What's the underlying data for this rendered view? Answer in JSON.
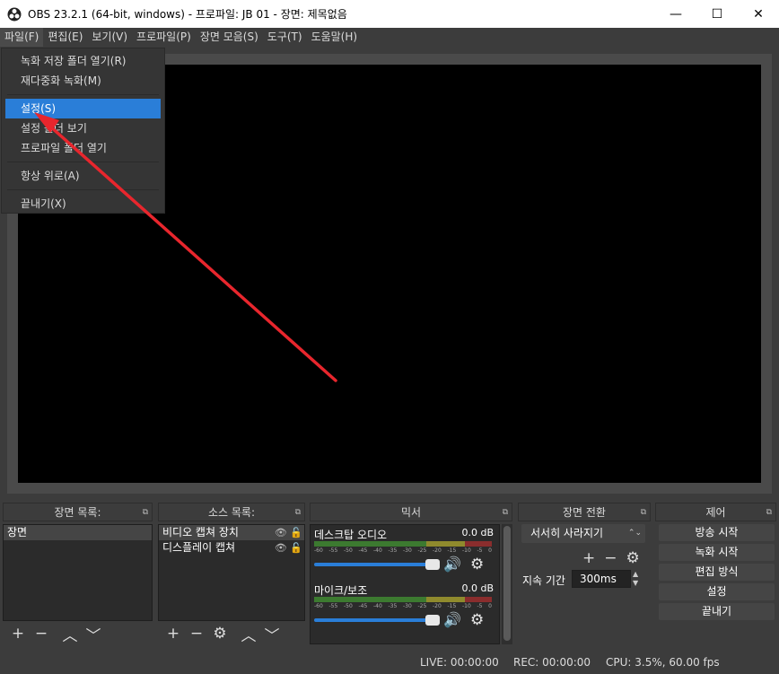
{
  "window": {
    "title": "OBS 23.2.1 (64-bit, windows) - 프로파일: JB 01 - 장면: 제목없음",
    "minimize": "—",
    "maximize": "☐",
    "close": "✕"
  },
  "menubar": [
    {
      "label": "파일(F)"
    },
    {
      "label": "편집(E)"
    },
    {
      "label": "보기(V)"
    },
    {
      "label": "프로파일(P)"
    },
    {
      "label": "장면 모음(S)"
    },
    {
      "label": "도구(T)"
    },
    {
      "label": "도움말(H)"
    }
  ],
  "file_menu": {
    "open_recording_folder": "녹화 저장 폴더 열기(R)",
    "remux_recording": "재다중화 녹화(M)",
    "settings": "설정(S)",
    "show_settings_folder": "설정 폴더 보기",
    "open_profile_folder": "프로파일 폴더 열기",
    "always_on_top": "항상 위로(A)",
    "exit": "끝내기(X)"
  },
  "docks": {
    "scenes": {
      "title": "장면 목록:",
      "items": [
        "장면"
      ]
    },
    "sources": {
      "title": "소스 목록:",
      "items": [
        "비디오 캡쳐 장치",
        "디스플레이 캡쳐"
      ]
    },
    "mixer": {
      "title": "믹서",
      "channels": [
        {
          "name": "데스크탑 오디오",
          "db": "0.0 dB"
        },
        {
          "name": "마이크/보조",
          "db": "0.0 dB"
        }
      ],
      "ticks": [
        "-60",
        "-55",
        "-50",
        "-45",
        "-40",
        "-35",
        "-30",
        "-25",
        "-20",
        "-15",
        "-10",
        "-5",
        "0"
      ]
    },
    "transitions": {
      "title": "장면 전환",
      "selected": "서서히 사라지기",
      "duration_label": "지속 기간",
      "duration_value": "300ms"
    },
    "controls": {
      "title": "제어",
      "start_streaming": "방송 시작",
      "start_recording": "녹화 시작",
      "studio_mode": "편집 방식",
      "settings": "설정",
      "exit": "끝내기"
    }
  },
  "status": {
    "live": "LIVE: 00:00:00",
    "rec": "REC: 00:00:00",
    "cpu": "CPU: 3.5%, 60.00 fps"
  },
  "colors": {
    "accent": "#2a7ed8",
    "arrow": "#e8262d"
  },
  "icons": [
    "obs-logo-icon",
    "plus-icon",
    "minus-icon",
    "chevron-up-icon",
    "chevron-down-icon",
    "gear-icon",
    "eye-icon",
    "lock-icon",
    "speaker-icon",
    "float-dock-icon"
  ]
}
